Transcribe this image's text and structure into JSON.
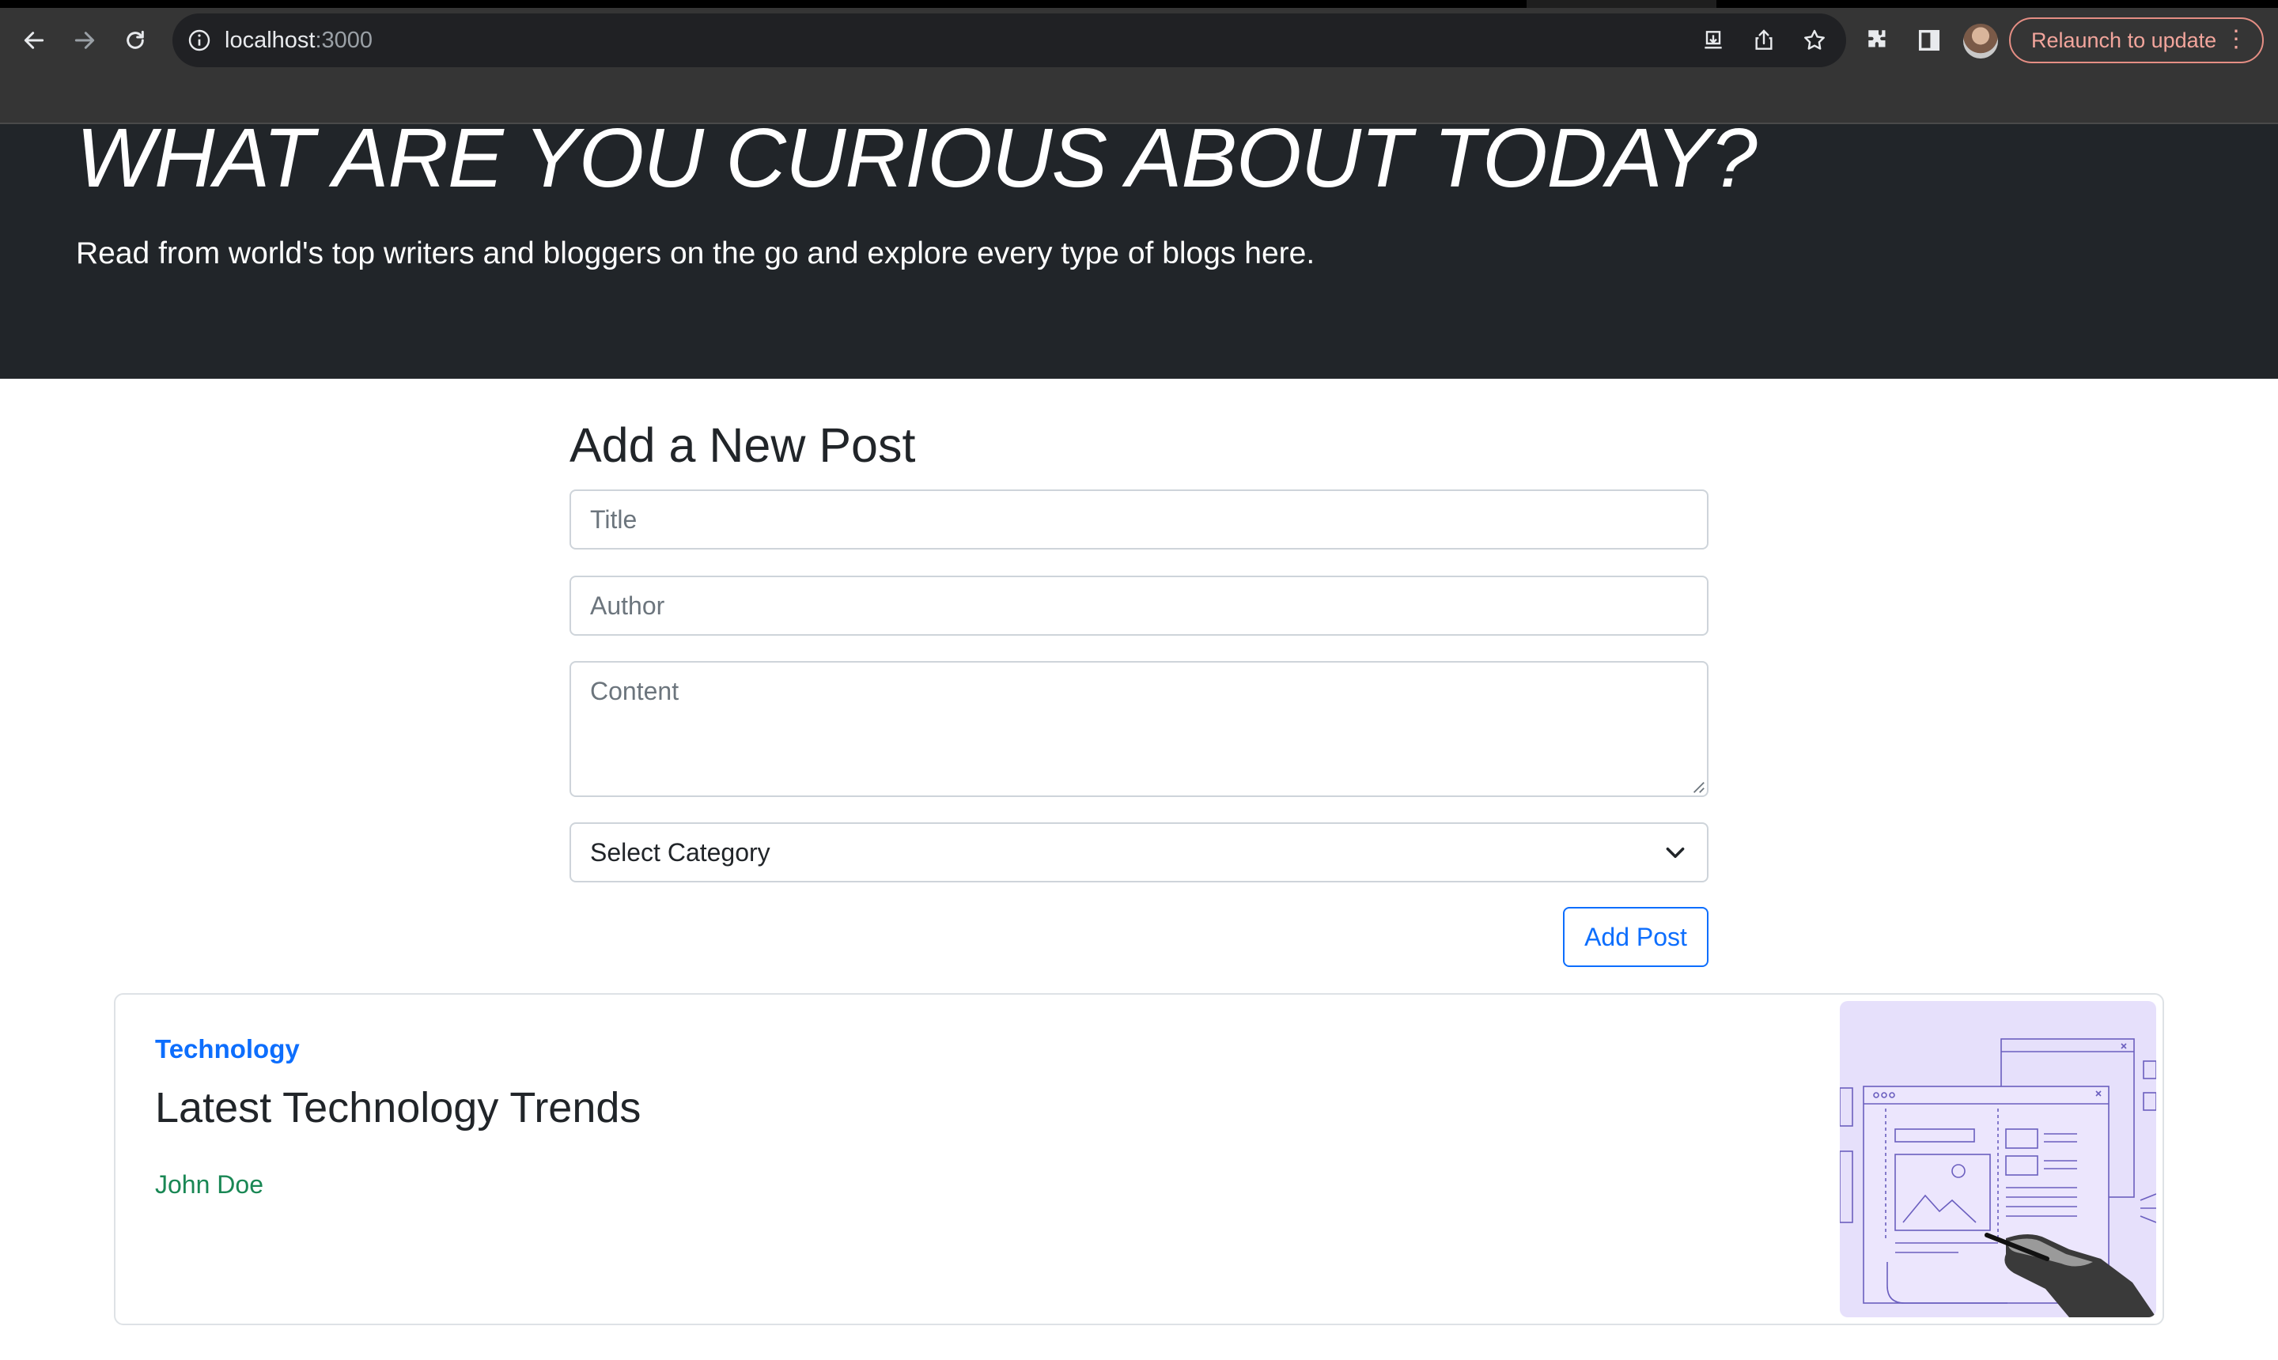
{
  "browser": {
    "url_host": "localhost",
    "url_port": ":3000",
    "relaunch_label": "Relaunch to update",
    "menu_glyph": "⋮",
    "icons": [
      "back-icon",
      "forward-icon",
      "reload-icon",
      "info-icon",
      "install-icon",
      "share-icon",
      "bookmark-star-icon",
      "extensions-icon",
      "side-panel-icon",
      "profile-avatar",
      "more-menu-icon"
    ]
  },
  "hero": {
    "title": "WHAT ARE YOU CURIOUS ABOUT TODAY?",
    "subtitle": "Read from world's top writers and bloggers on the go and explore every type of blogs here."
  },
  "form": {
    "heading": "Add a New Post",
    "title_placeholder": "Title",
    "author_placeholder": "Author",
    "content_placeholder": "Content",
    "category_selected": "Select Category",
    "submit_label": "Add Post"
  },
  "posts": [
    {
      "category": "Technology",
      "title": "Latest Technology Trends",
      "author": "John Doe"
    }
  ],
  "colors": {
    "hero_bg": "#212529",
    "primary": "#0d6efd",
    "author": "#198754",
    "relaunch": "#f2a59c",
    "image_bg": "#e6e0fb"
  }
}
